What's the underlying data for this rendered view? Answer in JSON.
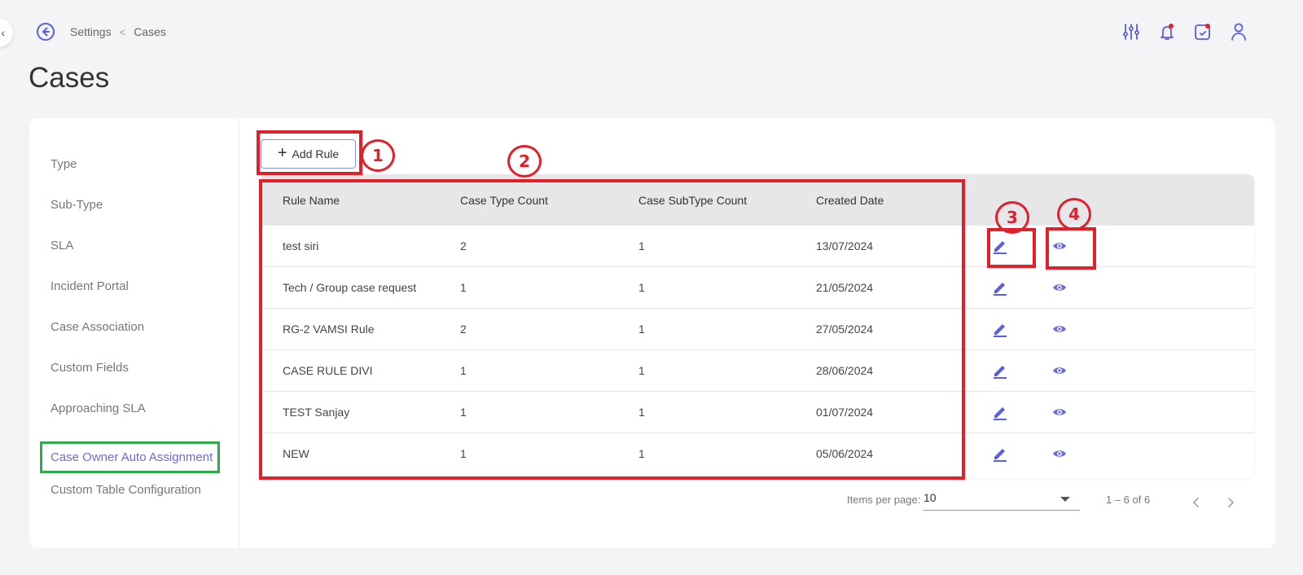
{
  "breadcrumb": {
    "items": [
      "Settings",
      "Cases"
    ],
    "separator": "<"
  },
  "page": {
    "title": "Cases"
  },
  "sidebar": {
    "items": [
      {
        "label": "Type"
      },
      {
        "label": "Sub-Type"
      },
      {
        "label": "SLA"
      },
      {
        "label": "Incident Portal"
      },
      {
        "label": "Case Association"
      },
      {
        "label": "Custom Fields"
      },
      {
        "label": "Approaching SLA"
      },
      {
        "label": "Case Owner Auto Assignment",
        "active": true
      },
      {
        "label": "Custom Table Configuration"
      }
    ]
  },
  "toolbar": {
    "add_rule_label": "Add Rule",
    "add_icon": "+"
  },
  "table": {
    "columns": [
      "Rule Name",
      "Case Type Count",
      "Case SubType Count",
      "Created Date"
    ],
    "rows": [
      [
        "test siri",
        "2",
        "1",
        "13/07/2024"
      ],
      [
        "Tech / Group case request",
        "1",
        "1",
        "21/05/2024"
      ],
      [
        "RG-2 VAMSI Rule",
        "2",
        "1",
        "27/05/2024"
      ],
      [
        "CASE RULE DIVI",
        "1",
        "1",
        "28/06/2024"
      ],
      [
        "TEST Sanjay",
        "1",
        "1",
        "01/07/2024"
      ],
      [
        "NEW",
        "1",
        "1",
        "05/06/2024"
      ]
    ]
  },
  "pagination": {
    "items_per_page_label": "Items per page:",
    "items_per_page_value": "10",
    "range_label": "1 – 6 of 6"
  },
  "annotations": {
    "labels": [
      "1",
      "2",
      "3",
      "4"
    ]
  },
  "colors": {
    "accent": "#6b6cd8",
    "icon": "#5a5ee0",
    "annotation": "#e0202a",
    "highlight": "#2eab4a",
    "notification_dot": "#e0202a"
  }
}
